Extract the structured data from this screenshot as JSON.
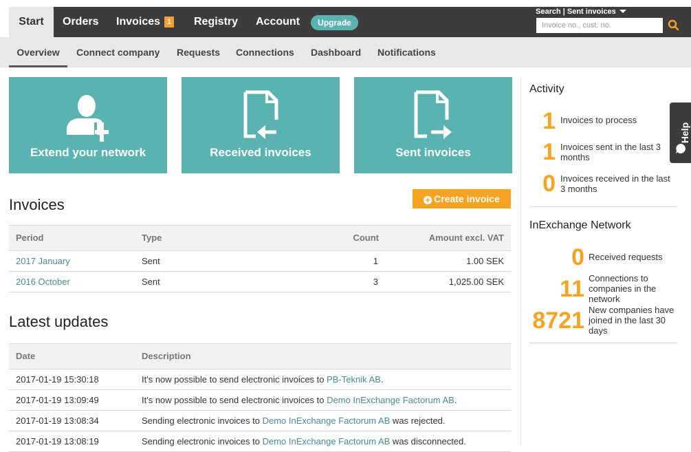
{
  "nav": {
    "tabs": [
      "Start",
      "Orders",
      "Invoices",
      "Registry",
      "Account"
    ],
    "invoices_badge": "1",
    "upgrade_label": "Upgrade"
  },
  "search": {
    "label": "Search | Sent invoices",
    "placeholder": "Invoice no., cust. no."
  },
  "subnav": {
    "items": [
      "Overview",
      "Connect company",
      "Requests",
      "Connections",
      "Dashboard",
      "Notifications"
    ]
  },
  "tiles": {
    "network": "Extend your network",
    "received": "Received invoices",
    "sent": "Sent invoices"
  },
  "invoices": {
    "title": "Invoices",
    "create_label": "Create invoice",
    "columns": [
      "Period",
      "Type",
      "Count",
      "Amount excl. VAT"
    ],
    "rows": [
      {
        "period": "2017 January",
        "type": "Sent",
        "count": "1",
        "amount": "1.00 SEK"
      },
      {
        "period": "2016 October",
        "type": "Sent",
        "count": "3",
        "amount": "1,025.00 SEK"
      }
    ]
  },
  "updates": {
    "title": "Latest updates",
    "columns": [
      "Date",
      "Description"
    ],
    "rows": [
      {
        "date": "2017-01-19 15:30:18",
        "pre": "It's now possible to send electronic invoices to ",
        "link": "PB-Teknik AB",
        "post": "."
      },
      {
        "date": "2017-01-19 13:09:49",
        "pre": "It's now possible to send electronic invoices to ",
        "link": "Demo InExchange Factorum AB",
        "post": "."
      },
      {
        "date": "2017-01-19 13:08:34",
        "pre": "Sending electronic invoices to ",
        "link": "Demo InExchange Factorum AB",
        "post": " was rejected."
      },
      {
        "date": "2017-01-19 13:08:19",
        "pre": "Sending electronic invoices to ",
        "link": "Demo InExchange Factorum AB",
        "post": " was disconnected."
      }
    ]
  },
  "activity": {
    "title": "Activity",
    "stats": [
      {
        "value": "1",
        "label": "Invoices to process"
      },
      {
        "value": "1",
        "label": "Invoices sent in the last 3 months"
      },
      {
        "value": "0",
        "label": "Invoices received in the last 3 months"
      }
    ]
  },
  "network": {
    "title": "InExchange Network",
    "stats": [
      {
        "value": "0",
        "label": "Received requests"
      },
      {
        "value": "11",
        "label": "Connections to companies in the network"
      },
      {
        "value": "8721",
        "label": "New companies have joined in the last 30 days"
      }
    ]
  },
  "help": {
    "label": "Help"
  },
  "colors": {
    "accent_teal": "#5ab3b0",
    "accent_orange": "#f5a321",
    "nav_dark": "#3c3c3c"
  }
}
